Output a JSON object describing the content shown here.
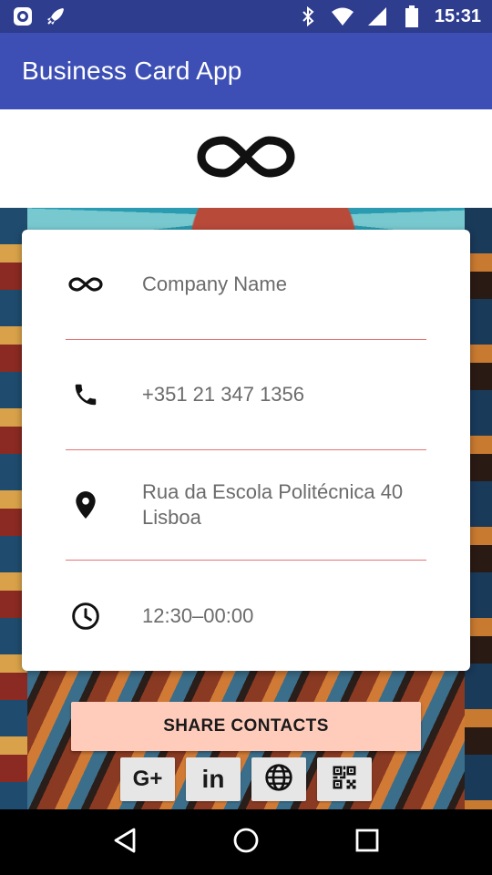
{
  "status_bar": {
    "time": "15:31",
    "icons_left": [
      "app-notification-icon",
      "rocket-notification-icon"
    ],
    "icons_right": [
      "bluetooth-icon",
      "wifi-icon",
      "cell-signal-icon",
      "battery-icon"
    ]
  },
  "app_bar": {
    "title": "Business Card App"
  },
  "header": {
    "logo": "infinity-logo-icon"
  },
  "card": {
    "rows": [
      {
        "icon": "infinity-icon",
        "text": "Company Name"
      },
      {
        "icon": "phone-icon",
        "text": "+351 21 347 1356"
      },
      {
        "icon": "location-pin-icon",
        "text": "Rua da Escola Politécnica 40\nLisboa"
      },
      {
        "icon": "clock-icon",
        "text": "12:30–00:00"
      }
    ]
  },
  "share_button": {
    "label": "SHARE CONTACTS"
  },
  "social": {
    "buttons": [
      {
        "icon": "google-plus-icon",
        "label": "G+"
      },
      {
        "icon": "linkedin-icon",
        "label": "in"
      },
      {
        "icon": "globe-icon"
      },
      {
        "icon": "qr-code-icon"
      }
    ]
  },
  "nav": {
    "buttons": [
      "back-icon",
      "home-icon",
      "recents-icon"
    ]
  },
  "colors": {
    "status_bar": "#2f3d8f",
    "app_bar": "#3d4fb5",
    "divider": "#e57373",
    "share_button": "#ffccbc",
    "social_button": "#e6e6e6"
  }
}
